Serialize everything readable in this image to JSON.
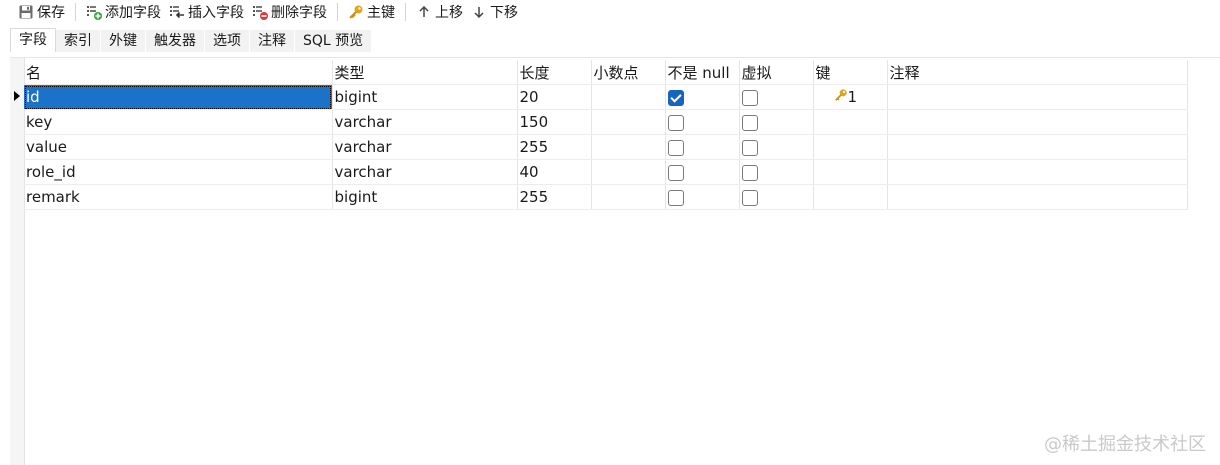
{
  "toolbar": {
    "save": "保存",
    "add_field": "添加字段",
    "insert_field": "插入字段",
    "delete_field": "删除字段",
    "primary_key": "主键",
    "move_up": "上移",
    "move_down": "下移"
  },
  "tabs": [
    "字段",
    "索引",
    "外键",
    "触发器",
    "选项",
    "注释",
    "SQL 预览"
  ],
  "columns": [
    "名",
    "类型",
    "长度",
    "小数点",
    "不是 null",
    "虚拟",
    "键",
    "注释"
  ],
  "rows": [
    {
      "name": "id",
      "type": "bigint",
      "length": "20",
      "decimal": "",
      "not_null": true,
      "virtual": false,
      "key": "1",
      "comment": ""
    },
    {
      "name": "key",
      "type": "varchar",
      "length": "150",
      "decimal": "",
      "not_null": false,
      "virtual": false,
      "key": "",
      "comment": ""
    },
    {
      "name": "value",
      "type": "varchar",
      "length": "255",
      "decimal": "",
      "not_null": false,
      "virtual": false,
      "key": "",
      "comment": ""
    },
    {
      "name": "role_id",
      "type": "varchar",
      "length": "40",
      "decimal": "",
      "not_null": false,
      "virtual": false,
      "key": "",
      "comment": ""
    },
    {
      "name": "remark",
      "type": "bigint",
      "length": "255",
      "decimal": "",
      "not_null": false,
      "virtual": false,
      "key": "",
      "comment": ""
    }
  ],
  "watermark": "@稀土掘金技术社区",
  "colors": {
    "selection": "#1a73c9",
    "checkbox_checked": "#1565c0",
    "key_icon": "#e0a51b"
  }
}
